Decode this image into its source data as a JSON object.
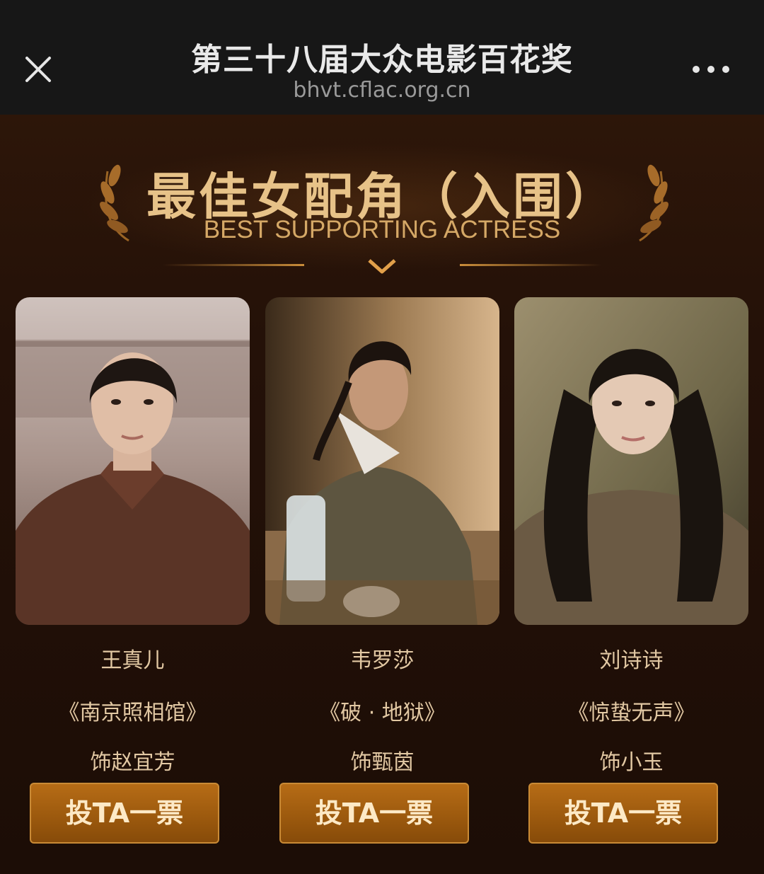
{
  "header": {
    "title": "第三十八届大众电影百花奖",
    "url": "bhvt.cflac.org.cn"
  },
  "banner": {
    "title": "最佳女配角（入围）",
    "subtitle": "BEST SUPPORTING ACTRESS"
  },
  "nominees": [
    {
      "name": "王真儿",
      "film": "《南京照相馆》",
      "role": "饰赵宜芳",
      "vote_label": "投TA一票"
    },
    {
      "name": "韦罗莎",
      "film": "《破 · 地狱》",
      "role": "饰甄茵",
      "vote_label": "投TA一票"
    },
    {
      "name": "刘诗诗",
      "film": "《惊蛰无声》",
      "role": "饰小玉",
      "vote_label": "投TA一票"
    }
  ],
  "colors": {
    "accent_gold": "#e7c288",
    "vote_button": "#9d5a0e",
    "background": "#1f0e07"
  }
}
